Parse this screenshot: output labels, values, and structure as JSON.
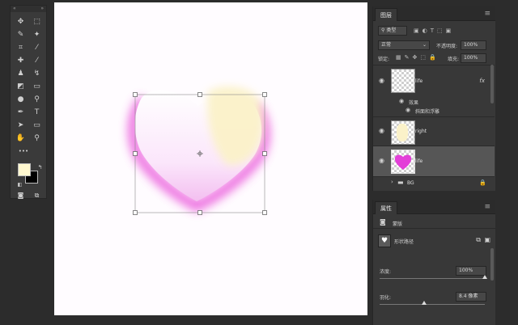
{
  "toolbar": {
    "grip_left": "«",
    "grip_right": "»",
    "tools": [
      {
        "name": "move-tool",
        "glyph": "✥"
      },
      {
        "name": "marquee-tool",
        "glyph": "⬚"
      },
      {
        "name": "lasso-tool",
        "glyph": "✎"
      },
      {
        "name": "magic-wand-tool",
        "glyph": "✦"
      },
      {
        "name": "crop-tool",
        "glyph": "⌗"
      },
      {
        "name": "eyedropper-tool",
        "glyph": "⁄"
      },
      {
        "name": "healing-brush-tool",
        "glyph": "✚"
      },
      {
        "name": "brush-tool",
        "glyph": "⁄"
      },
      {
        "name": "stamp-tool",
        "glyph": "♟"
      },
      {
        "name": "history-brush-tool",
        "glyph": "↯"
      },
      {
        "name": "eraser-tool",
        "glyph": "◩"
      },
      {
        "name": "gradient-tool",
        "glyph": "▭"
      },
      {
        "name": "blur-tool",
        "glyph": "●"
      },
      {
        "name": "dodge-tool",
        "glyph": "⚲"
      },
      {
        "name": "pen-tool",
        "glyph": "✒"
      },
      {
        "name": "type-tool",
        "glyph": "T"
      },
      {
        "name": "path-selection-tool",
        "glyph": "➤"
      },
      {
        "name": "shape-tool",
        "glyph": "▭"
      },
      {
        "name": "hand-tool",
        "glyph": "✋"
      },
      {
        "name": "zoom-tool",
        "glyph": "⚲"
      },
      {
        "name": "more-tools",
        "glyph": "•••"
      }
    ]
  },
  "colors": {
    "foreground": "#fff8cf",
    "background": "#000000",
    "accent": "#e040d8"
  },
  "layers_panel": {
    "tab_label": "图层",
    "menu_icon": "≡",
    "filter_label": "类型",
    "blend_mode": "正常",
    "opacity_label": "不透明度:",
    "opacity_value": "100%",
    "lock_label": "锁定:",
    "fill_label": "填充:",
    "fill_value": "100%",
    "layers": [
      {
        "name": "life",
        "fx": "fx"
      },
      {
        "effects_label": "效果",
        "effect_name": "斜面和浮雕"
      },
      {
        "name": "right"
      },
      {
        "name": "life"
      },
      {
        "name": "BG"
      }
    ]
  },
  "properties_panel": {
    "tab_label": "属性",
    "mask_label": "蒙版",
    "shape_path_label": "形状路径",
    "density_label": "浓度:",
    "density_value": "100%",
    "feather_label": "羽化:",
    "feather_value": "8.4 像素",
    "density_level": 1.0,
    "feather_level": 0.42
  }
}
